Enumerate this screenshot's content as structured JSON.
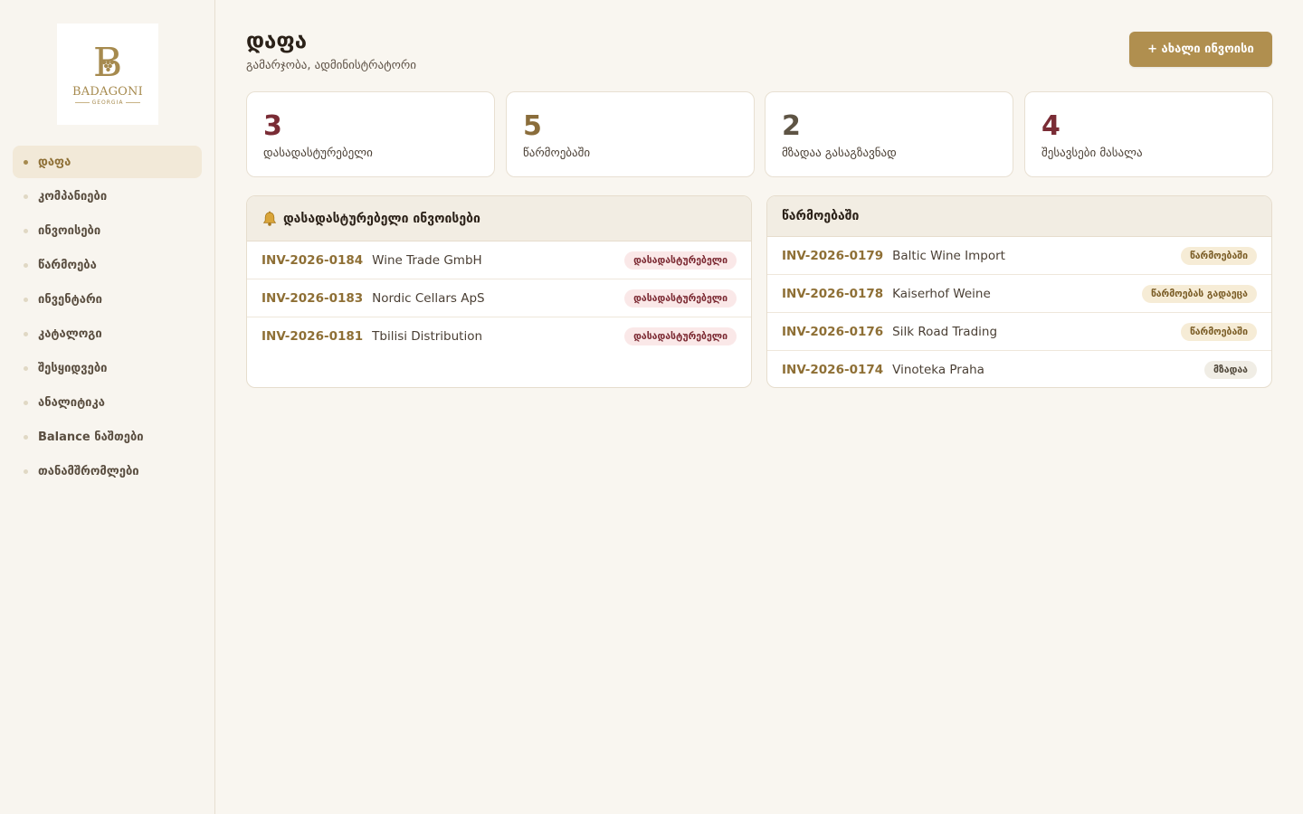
{
  "brand": {
    "name": "BADAGONI",
    "sub": "GEORGIA",
    "letter": "B"
  },
  "sidebar": {
    "items": [
      {
        "label": "დაფა",
        "active": true
      },
      {
        "label": "კომპანიები",
        "active": false
      },
      {
        "label": "ინვოისები",
        "active": false
      },
      {
        "label": "წარმოება",
        "active": false
      },
      {
        "label": "ინვენტარი",
        "active": false
      },
      {
        "label": "კატალოგი",
        "active": false
      },
      {
        "label": "შესყიდვები",
        "active": false
      },
      {
        "label": "ანალიტიკა",
        "active": false
      },
      {
        "label": "Balance ნაშთები",
        "active": false
      },
      {
        "label": "თანამშრომლები",
        "active": false
      }
    ]
  },
  "header": {
    "title": "დაფა",
    "subtitle": "გამარჯობა, ადმინისტრატორი",
    "new_button": "+ ახალი ინვოისი"
  },
  "stats": [
    {
      "value": "3",
      "label": "დასადასტურებელი",
      "color": "#7a2c35"
    },
    {
      "value": "5",
      "label": "წარმოებაში",
      "color": "#8a6d3b"
    },
    {
      "value": "2",
      "label": "მზადაა გასაგზავნად",
      "color": "#5e5444"
    },
    {
      "value": "4",
      "label": "შესავსები მასალა",
      "color": "#7a2c35"
    }
  ],
  "pending_panel": {
    "title": "დასადასტურებელი ინვოისები",
    "icon": "bell-icon",
    "rows": [
      {
        "id": "INV-2026-0184",
        "name": "Wine Trade GmbH",
        "status": "დასადასტურებელი"
      },
      {
        "id": "INV-2026-0183",
        "name": "Nordic Cellars ApS",
        "status": "დასადასტურებელი"
      },
      {
        "id": "INV-2026-0181",
        "name": "Tbilisi Distribution",
        "status": "დასადასტურებელი"
      }
    ]
  },
  "production_panel": {
    "title": "წარმოებაში",
    "rows": [
      {
        "id": "INV-2026-0179",
        "name": "Baltic Wine Import",
        "status": "წარმოებაში",
        "kind": "prod"
      },
      {
        "id": "INV-2026-0178",
        "name": "Kaiserhof Weine",
        "status": "წარმოებას გადაეცა",
        "kind": "prod"
      },
      {
        "id": "INV-2026-0176",
        "name": "Silk Road Trading",
        "status": "წარმოებაში",
        "kind": "prod"
      },
      {
        "id": "INV-2026-0174",
        "name": "Vinoteka Praha",
        "status": "მზადაა",
        "kind": "ready"
      }
    ]
  },
  "colors": {
    "accent": "#b08f4f",
    "background": "#f9f6f0",
    "wine": "#7a2c35"
  }
}
